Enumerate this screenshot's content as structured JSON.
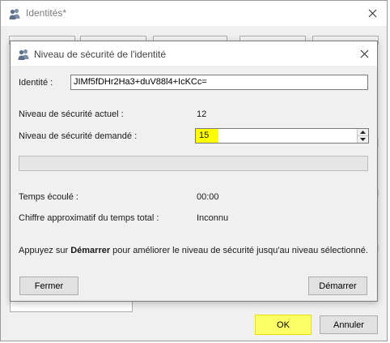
{
  "window": {
    "title": "Identités*",
    "ok_label": "OK",
    "cancel_label": "Annuler"
  },
  "dialog": {
    "title": "Niveau de sécurité de l'identité",
    "identity_label": "Identité :",
    "identity_value": "JIMf5fDHr2Ha3+duV88l4+IcKCc=",
    "current_level_label": "Niveau de sécurité actuel :",
    "current_level_value": "12",
    "requested_level_label": "Niveau de sécurité demandé :",
    "requested_level_value": "15",
    "progress_fraction": 0,
    "elapsed_label": "Temps écoulé :",
    "elapsed_value": "00:00",
    "estimate_label": "Chiffre approximatif du temps total :",
    "estimate_value": "Inconnu",
    "message_prefix": "Appuyez sur ",
    "message_bold": "Démarrer",
    "message_suffix": " pour améliorer le niveau de sécurité jusqu'au niveau sélectionné.",
    "close_button_label": "Fermer",
    "start_button_label": "Démarrer"
  },
  "icons": {
    "window_icon": "users-icon",
    "dialog_icon": "users-icon",
    "close": "close-icon",
    "spin_up": "chevron-up-icon",
    "spin_down": "chevron-down-icon"
  },
  "colors": {
    "highlight": "#ffff00",
    "ok_highlight": "#ffff66",
    "icon": "#6e7f9a"
  }
}
